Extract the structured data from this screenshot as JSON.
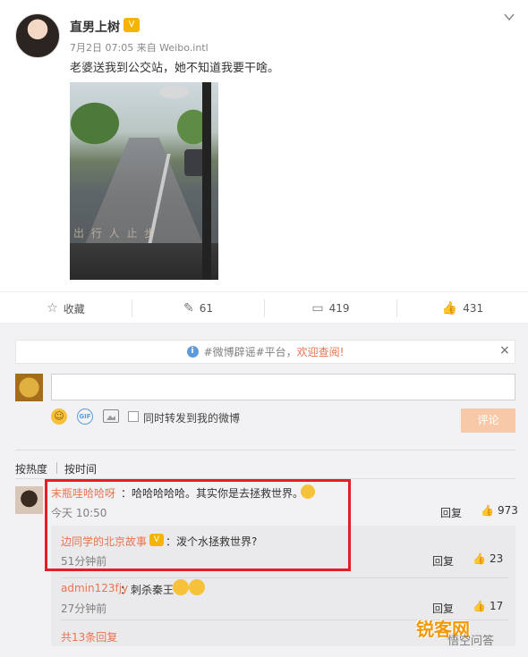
{
  "post": {
    "username": "直男上树",
    "badge": "V",
    "meta": "7月2日 07:05 来自 Weibo.intl",
    "text": "老婆送我到公交站，她不知道我要干啥。",
    "video_overlay_text": "出 行 人 止 步"
  },
  "actions": [
    {
      "icon": "☆",
      "label": "收藏"
    },
    {
      "icon": "✎",
      "label": "61"
    },
    {
      "icon": "▭",
      "label": "419"
    },
    {
      "icon": "👍",
      "label": "431"
    }
  ],
  "notice": {
    "icon": "i",
    "prefix": "#微博辟谣#平台，",
    "link": "欢迎查阅!",
    "close": "×"
  },
  "composer": {
    "gif_label": "GIF",
    "repost_label": "同时转发到我的微博",
    "submit_label": "评论"
  },
  "sort": {
    "hot": "按热度",
    "time": "按时间"
  },
  "comments": [
    {
      "name": "末瓶哇哈哈呀",
      "text": "：哈哈哈哈哈。其实你是去拯救世界。",
      "time": "今天 10:50",
      "reply": "回复",
      "likes": "973",
      "replies": [
        {
          "name": "边同学的北京故事",
          "text": "：泼个水拯救世界?",
          "time": "51分钟前",
          "reply": "回复",
          "likes": "23"
        },
        {
          "name": "admin123fjy",
          "text": "：刺杀秦王",
          "time": "27分钟前",
          "reply": "回复",
          "likes": "17"
        }
      ],
      "more": "共13条回复"
    }
  ],
  "watermark": {
    "brand": "锐客网",
    "sub": "悟空问答"
  },
  "colors": {
    "accent": "#eb7350",
    "highlight": "#e21e26",
    "link_blue": "#5e9bd8"
  }
}
